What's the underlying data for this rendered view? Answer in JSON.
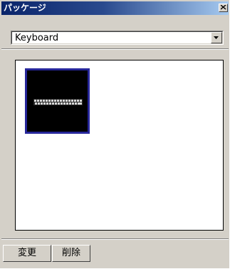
{
  "window": {
    "title": "パッケージ"
  },
  "package_select": {
    "selected": "Keyboard"
  },
  "buttons": {
    "change": "変更",
    "delete": "削除"
  },
  "icons": {
    "close": "close-icon",
    "dropdown": "chevron-down-icon",
    "package_thumbnail": "keyboard-icon"
  },
  "colors": {
    "titlebar_start": "#0a246a",
    "titlebar_end": "#a6caf0",
    "selection_border": "#27279a",
    "window_face": "#d4d0c8"
  }
}
